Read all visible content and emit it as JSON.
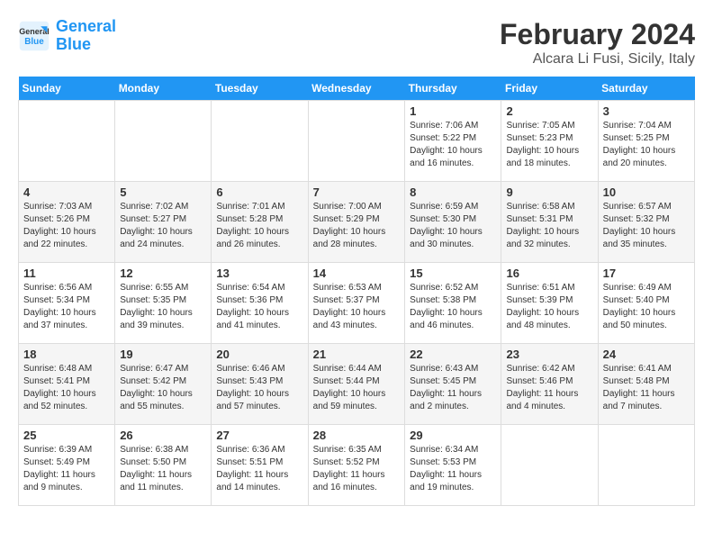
{
  "header": {
    "logo_line1": "General",
    "logo_line2": "Blue",
    "main_title": "February 2024",
    "subtitle": "Alcara Li Fusi, Sicily, Italy"
  },
  "days_of_week": [
    "Sunday",
    "Monday",
    "Tuesday",
    "Wednesday",
    "Thursday",
    "Friday",
    "Saturday"
  ],
  "weeks": [
    [
      {
        "day": "",
        "info": ""
      },
      {
        "day": "",
        "info": ""
      },
      {
        "day": "",
        "info": ""
      },
      {
        "day": "",
        "info": ""
      },
      {
        "day": "1",
        "info": "Sunrise: 7:06 AM\nSunset: 5:22 PM\nDaylight: 10 hours\nand 16 minutes."
      },
      {
        "day": "2",
        "info": "Sunrise: 7:05 AM\nSunset: 5:23 PM\nDaylight: 10 hours\nand 18 minutes."
      },
      {
        "day": "3",
        "info": "Sunrise: 7:04 AM\nSunset: 5:25 PM\nDaylight: 10 hours\nand 20 minutes."
      }
    ],
    [
      {
        "day": "4",
        "info": "Sunrise: 7:03 AM\nSunset: 5:26 PM\nDaylight: 10 hours\nand 22 minutes."
      },
      {
        "day": "5",
        "info": "Sunrise: 7:02 AM\nSunset: 5:27 PM\nDaylight: 10 hours\nand 24 minutes."
      },
      {
        "day": "6",
        "info": "Sunrise: 7:01 AM\nSunset: 5:28 PM\nDaylight: 10 hours\nand 26 minutes."
      },
      {
        "day": "7",
        "info": "Sunrise: 7:00 AM\nSunset: 5:29 PM\nDaylight: 10 hours\nand 28 minutes."
      },
      {
        "day": "8",
        "info": "Sunrise: 6:59 AM\nSunset: 5:30 PM\nDaylight: 10 hours\nand 30 minutes."
      },
      {
        "day": "9",
        "info": "Sunrise: 6:58 AM\nSunset: 5:31 PM\nDaylight: 10 hours\nand 32 minutes."
      },
      {
        "day": "10",
        "info": "Sunrise: 6:57 AM\nSunset: 5:32 PM\nDaylight: 10 hours\nand 35 minutes."
      }
    ],
    [
      {
        "day": "11",
        "info": "Sunrise: 6:56 AM\nSunset: 5:34 PM\nDaylight: 10 hours\nand 37 minutes."
      },
      {
        "day": "12",
        "info": "Sunrise: 6:55 AM\nSunset: 5:35 PM\nDaylight: 10 hours\nand 39 minutes."
      },
      {
        "day": "13",
        "info": "Sunrise: 6:54 AM\nSunset: 5:36 PM\nDaylight: 10 hours\nand 41 minutes."
      },
      {
        "day": "14",
        "info": "Sunrise: 6:53 AM\nSunset: 5:37 PM\nDaylight: 10 hours\nand 43 minutes."
      },
      {
        "day": "15",
        "info": "Sunrise: 6:52 AM\nSunset: 5:38 PM\nDaylight: 10 hours\nand 46 minutes."
      },
      {
        "day": "16",
        "info": "Sunrise: 6:51 AM\nSunset: 5:39 PM\nDaylight: 10 hours\nand 48 minutes."
      },
      {
        "day": "17",
        "info": "Sunrise: 6:49 AM\nSunset: 5:40 PM\nDaylight: 10 hours\nand 50 minutes."
      }
    ],
    [
      {
        "day": "18",
        "info": "Sunrise: 6:48 AM\nSunset: 5:41 PM\nDaylight: 10 hours\nand 52 minutes."
      },
      {
        "day": "19",
        "info": "Sunrise: 6:47 AM\nSunset: 5:42 PM\nDaylight: 10 hours\nand 55 minutes."
      },
      {
        "day": "20",
        "info": "Sunrise: 6:46 AM\nSunset: 5:43 PM\nDaylight: 10 hours\nand 57 minutes."
      },
      {
        "day": "21",
        "info": "Sunrise: 6:44 AM\nSunset: 5:44 PM\nDaylight: 10 hours\nand 59 minutes."
      },
      {
        "day": "22",
        "info": "Sunrise: 6:43 AM\nSunset: 5:45 PM\nDaylight: 11 hours\nand 2 minutes."
      },
      {
        "day": "23",
        "info": "Sunrise: 6:42 AM\nSunset: 5:46 PM\nDaylight: 11 hours\nand 4 minutes."
      },
      {
        "day": "24",
        "info": "Sunrise: 6:41 AM\nSunset: 5:48 PM\nDaylight: 11 hours\nand 7 minutes."
      }
    ],
    [
      {
        "day": "25",
        "info": "Sunrise: 6:39 AM\nSunset: 5:49 PM\nDaylight: 11 hours\nand 9 minutes."
      },
      {
        "day": "26",
        "info": "Sunrise: 6:38 AM\nSunset: 5:50 PM\nDaylight: 11 hours\nand 11 minutes."
      },
      {
        "day": "27",
        "info": "Sunrise: 6:36 AM\nSunset: 5:51 PM\nDaylight: 11 hours\nand 14 minutes."
      },
      {
        "day": "28",
        "info": "Sunrise: 6:35 AM\nSunset: 5:52 PM\nDaylight: 11 hours\nand 16 minutes."
      },
      {
        "day": "29",
        "info": "Sunrise: 6:34 AM\nSunset: 5:53 PM\nDaylight: 11 hours\nand 19 minutes."
      },
      {
        "day": "",
        "info": ""
      },
      {
        "day": "",
        "info": ""
      }
    ]
  ]
}
